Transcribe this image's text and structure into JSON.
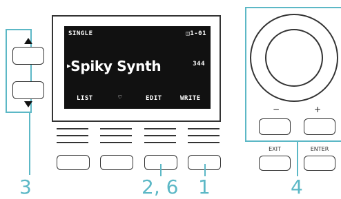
{
  "display": {
    "mode": "SINGLE",
    "program_number": "1-01",
    "program_name": "Spiky Synth",
    "tempo": "344",
    "soft_keys": [
      "LIST",
      "♡",
      "EDIT",
      "WRITE"
    ]
  },
  "dial_section": {
    "minus_label": "−",
    "plus_label": "+",
    "exit_label": "EXIT",
    "enter_label": "ENTER"
  },
  "callouts": {
    "cursor_buttons": "3",
    "function_buttons": "2, 6",
    "write_button": "1",
    "value_controls": "4"
  },
  "colors": {
    "annotation": "#5cb8c6",
    "screen": "#111111",
    "outline": "#333333"
  }
}
